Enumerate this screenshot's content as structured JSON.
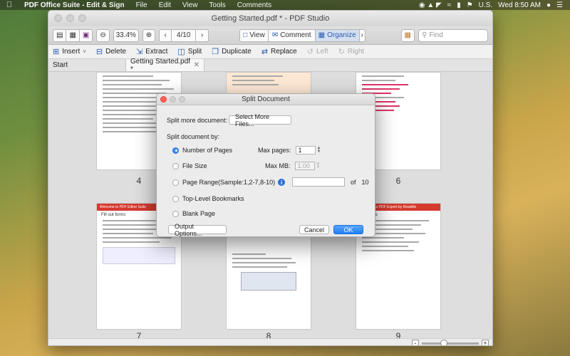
{
  "menubar": {
    "app_name": "PDF Office Suite - Edit & Sign",
    "items": [
      "File",
      "Edit",
      "View",
      "Tools",
      "Comments"
    ],
    "input_source": "U.S.",
    "clock": "Wed 8:50 AM"
  },
  "window": {
    "title": "Getting Started.pdf * - PDF Studio"
  },
  "toolbar": {
    "zoom": "33.4%",
    "page_indicator": "4/10",
    "modes": {
      "view": "View",
      "comment": "Comment",
      "organize": "Organize"
    },
    "search_placeholder": "Find"
  },
  "organize_bar": {
    "insert": "Insert",
    "delete": "Delete",
    "extract": "Extract",
    "split": "Split",
    "duplicate": "Duplicate",
    "replace": "Replace",
    "left": "Left",
    "right": "Right"
  },
  "tabs": [
    {
      "label": "Start"
    },
    {
      "label": "Getting Started.pdf *"
    }
  ],
  "page_numbers": {
    "p4": "4",
    "p6": "6",
    "p7": "7",
    "p8": "8",
    "p9": "9"
  },
  "thumb_headers": {
    "p7_title": "Welcome to PDF Editor Suite",
    "p7_sub": "Fill out forms",
    "p9_title": "Welcome to PDF Expert by Readdle",
    "p9_sub": "Features"
  },
  "dialog": {
    "title": "Split Document",
    "split_more_label": "Split more document:",
    "select_files_btn": "Select More Files...",
    "split_by_label": "Split document by:",
    "options": {
      "number_of_pages": "Number of Pages",
      "file_size": "File Size",
      "page_range": "Page Range(Sample:1,2-7,8-10)",
      "bookmarks": "Top-Level Bookmarks",
      "blank_page": "Blank Page"
    },
    "max_pages_label": "Max pages:",
    "max_pages_value": "1",
    "max_mb_label": "Max MB:",
    "max_mb_value": "1.00",
    "of_label": "of",
    "total_pages": "10",
    "output_options_btn": "Output Options...",
    "cancel_btn": "Cancel",
    "ok_btn": "OK"
  },
  "colors": {
    "accent": "#1f7ef7",
    "page_selected": "#fde8d4",
    "thumb_red": "#d53a2f"
  }
}
